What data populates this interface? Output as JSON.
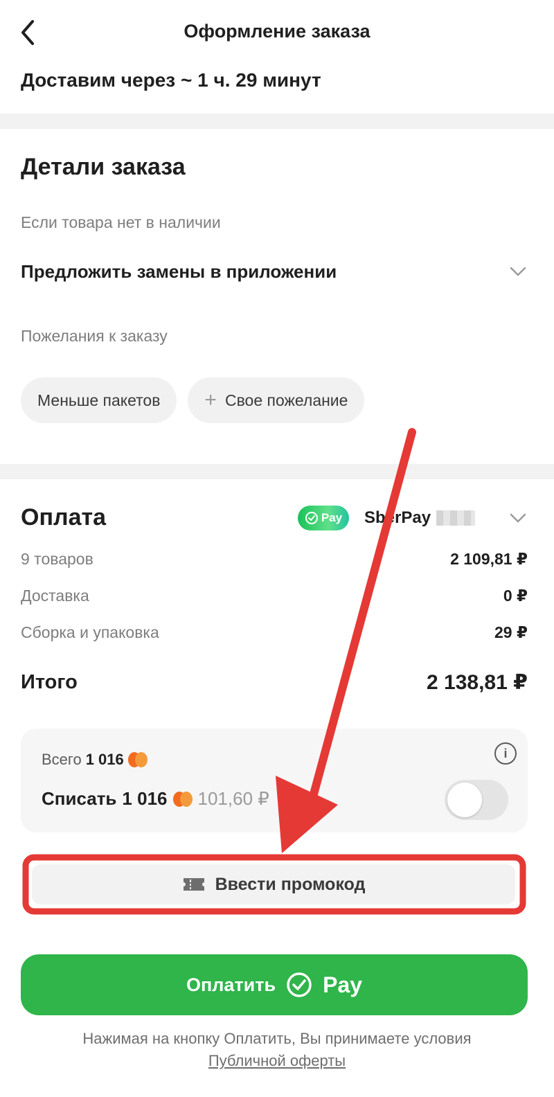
{
  "header": {
    "title": "Оформление заказа",
    "delivery_text": "Доставим через ~ 1 ч. 29 минут"
  },
  "order_details": {
    "title": "Детали заказа",
    "out_of_stock_label": "Если товара нет в наличии",
    "out_of_stock_value": "Предложить замены в приложении",
    "wishes_label": "Пожелания к заказу",
    "chips": [
      {
        "label": "Меньше пакетов"
      },
      {
        "label": "Свое пожелание",
        "icon": "plus-icon"
      }
    ]
  },
  "payment": {
    "title": "Оплата",
    "method_badge": "Pay",
    "method_name": "SberPay",
    "rows": [
      {
        "label": "9 товаров",
        "value": "2 109,81 ₽"
      },
      {
        "label": "Доставка",
        "value": "0 ₽"
      },
      {
        "label": "Сборка и упаковка",
        "value": "29 ₽"
      }
    ],
    "total_label": "Итого",
    "total_value": "2 138,81 ₽"
  },
  "bonus": {
    "total_prefix": "Всего",
    "total_amount": "1 016",
    "spend_prefix": "Списать",
    "spend_amount": "1 016",
    "spend_rub": "101,60 ₽",
    "toggle_on": false,
    "coin_colors": [
      "#f26b1f",
      "#f49a3b"
    ]
  },
  "promo": {
    "label": "Ввести промокод",
    "highlight_color": "#e53935"
  },
  "pay_button": {
    "label": "Оплатить",
    "brand": "Pay",
    "color": "#2fb54a"
  },
  "terms": {
    "text": "Нажимая на кнопку Оплатить, Вы принимаете условия",
    "link": "Публичной оферты"
  }
}
